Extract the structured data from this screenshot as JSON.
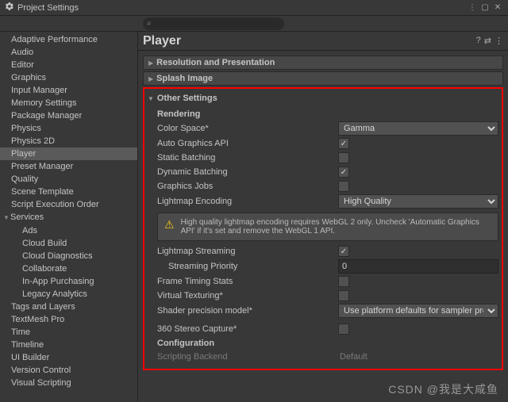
{
  "window": {
    "title": "Project Settings"
  },
  "search": {
    "placeholder": ""
  },
  "sidebar": {
    "items": [
      {
        "label": "Adaptive Performance"
      },
      {
        "label": "Audio"
      },
      {
        "label": "Editor"
      },
      {
        "label": "Graphics"
      },
      {
        "label": "Input Manager"
      },
      {
        "label": "Memory Settings"
      },
      {
        "label": "Package Manager"
      },
      {
        "label": "Physics"
      },
      {
        "label": "Physics 2D"
      },
      {
        "label": "Player",
        "selected": true
      },
      {
        "label": "Preset Manager"
      },
      {
        "label": "Quality"
      },
      {
        "label": "Scene Template"
      },
      {
        "label": "Script Execution Order"
      },
      {
        "label": "Services",
        "expanded": true
      },
      {
        "label": "Ads",
        "child": true
      },
      {
        "label": "Cloud Build",
        "child": true
      },
      {
        "label": "Cloud Diagnostics",
        "child": true
      },
      {
        "label": "Collaborate",
        "child": true
      },
      {
        "label": "In-App Purchasing",
        "child": true
      },
      {
        "label": "Legacy Analytics",
        "child": true
      },
      {
        "label": "Tags and Layers"
      },
      {
        "label": "TextMesh Pro"
      },
      {
        "label": "Time"
      },
      {
        "label": "Timeline"
      },
      {
        "label": "UI Builder"
      },
      {
        "label": "Version Control"
      },
      {
        "label": "Visual Scripting"
      }
    ]
  },
  "content": {
    "title": "Player",
    "sections": {
      "resolution": "Resolution and Presentation",
      "splash": "Splash Image",
      "other": "Other Settings"
    },
    "rendering": {
      "heading": "Rendering",
      "color_space_lbl": "Color Space*",
      "color_space_val": "Gamma",
      "auto_gfx_lbl": "Auto Graphics API",
      "auto_gfx_val": true,
      "static_batch_lbl": "Static Batching",
      "static_batch_val": false,
      "dyn_batch_lbl": "Dynamic Batching",
      "dyn_batch_val": true,
      "gfx_jobs_lbl": "Graphics Jobs",
      "gfx_jobs_val": false,
      "lightmap_enc_lbl": "Lightmap Encoding",
      "lightmap_enc_val": "High Quality",
      "warning": "High quality lightmap encoding requires WebGL 2 only. Uncheck 'Automatic Graphics API' if it's set and remove the WebGL 1 API.",
      "lm_stream_lbl": "Lightmap Streaming",
      "lm_stream_val": true,
      "stream_prio_lbl": "Streaming Priority",
      "stream_prio_val": "0",
      "frame_timing_lbl": "Frame Timing Stats",
      "frame_timing_val": false,
      "vtex_lbl": "Virtual Texturing*",
      "vtex_val": false,
      "shader_prec_lbl": "Shader precision model*",
      "shader_prec_val": "Use platform defaults for sampler precision",
      "stereo_lbl": "360 Stereo Capture*",
      "stereo_val": false
    },
    "configuration": {
      "heading": "Configuration",
      "scripting_backend_lbl": "Scripting Backend",
      "scripting_backend_val": "Default"
    }
  },
  "watermark": "CSDN @我是大咸鱼"
}
